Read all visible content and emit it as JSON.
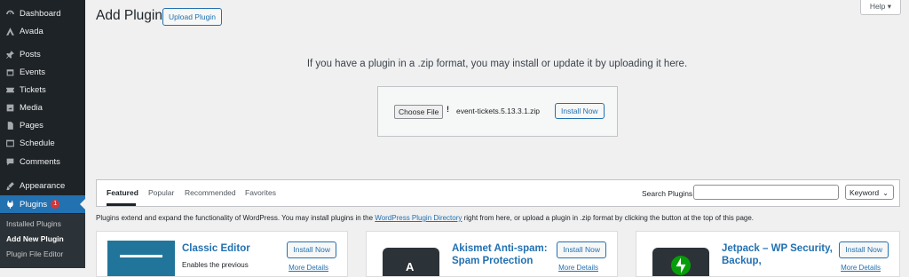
{
  "sidebar": {
    "items": [
      {
        "label": "Dashboard",
        "icon": "dashboard-icon"
      },
      {
        "label": "Avada",
        "icon": "avada-icon"
      },
      {
        "label": "Posts",
        "icon": "pin-icon"
      },
      {
        "label": "Events",
        "icon": "calendar-icon"
      },
      {
        "label": "Tickets",
        "icon": "ticket-icon"
      },
      {
        "label": "Media",
        "icon": "media-icon"
      },
      {
        "label": "Pages",
        "icon": "page-icon"
      },
      {
        "label": "Schedule",
        "icon": "schedule-icon"
      },
      {
        "label": "Comments",
        "icon": "comment-icon"
      },
      {
        "label": "Appearance",
        "icon": "brush-icon"
      },
      {
        "label": "Plugins",
        "icon": "plugin-icon",
        "badge": "1"
      }
    ],
    "submenu": [
      "Installed Plugins",
      "Add New Plugin",
      "Plugin File Editor"
    ]
  },
  "header": {
    "title": "Add Plugins",
    "upload_button": "Upload Plugin",
    "help_button": "Help ▾"
  },
  "upload": {
    "instructions": "If you have a plugin in a .zip format, you may install or update it by uploading it here.",
    "choose_file": "Choose File",
    "warning": "!",
    "filename": "event-tickets.5.13.3.1.zip",
    "install_button": "Install Now"
  },
  "filter": {
    "tabs": [
      "Featured",
      "Popular",
      "Recommended",
      "Favorites"
    ],
    "search_label": "Search Plugins",
    "search_value": "",
    "search_type": "Keyword",
    "search_type_chevron": "⌄"
  },
  "intro": {
    "before": "Plugins extend and expand the functionality of WordPress. You may install plugins in the ",
    "link": "WordPress Plugin Directory",
    "after": " right from here, or upload a plugin in .zip format by clicking the button at the top of this page."
  },
  "cards": [
    {
      "name": "Classic Editor",
      "description": "Enables the previous",
      "install": "Install Now",
      "more": "More Details"
    },
    {
      "name": "Akismet Anti-spam: Spam Protection",
      "description": "",
      "install": "Install Now",
      "more": "More Details"
    },
    {
      "name": "Jetpack – WP Security, Backup,",
      "description": "",
      "install": "Install Now",
      "more": "More Details"
    }
  ],
  "colors": {
    "accent": "#2271b1",
    "sidebar": "#1d2327",
    "badge": "#d63638",
    "jetpack": "#069e08"
  }
}
